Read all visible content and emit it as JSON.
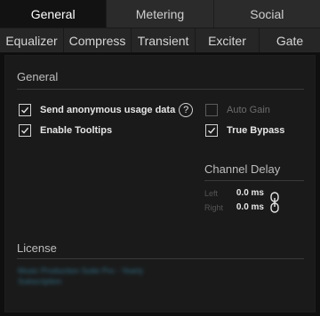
{
  "tabs_main": [
    "General",
    "Metering",
    "Social"
  ],
  "tabs_sub": [
    "Equalizer",
    "Compress",
    "Transient",
    "Exciter",
    "Gate"
  ],
  "general": {
    "title": "General",
    "send_usage_label": "Send anonymous usage data",
    "send_usage_checked": true,
    "help_glyph": "?",
    "auto_gain_label": "Auto Gain",
    "auto_gain_checked": false,
    "enable_tooltips_label": "Enable Tooltips",
    "enable_tooltips_checked": true,
    "true_bypass_label": "True Bypass",
    "true_bypass_checked": true
  },
  "channel_delay": {
    "title": "Channel Delay",
    "left_label": "Left",
    "left_value": "0.0 ms",
    "right_label": "Right",
    "right_value": "0.0 ms",
    "link_icon": "link-icon"
  },
  "license": {
    "title": "License",
    "text": "Music Production Suite Pro - Yearly Subscription"
  },
  "colors": {
    "background": "#0f0f0f",
    "panel": "#1a1a1a",
    "tab_active": "#121212",
    "tab_inactive": "#2b2b2b",
    "license_text": "#2f6f86"
  }
}
